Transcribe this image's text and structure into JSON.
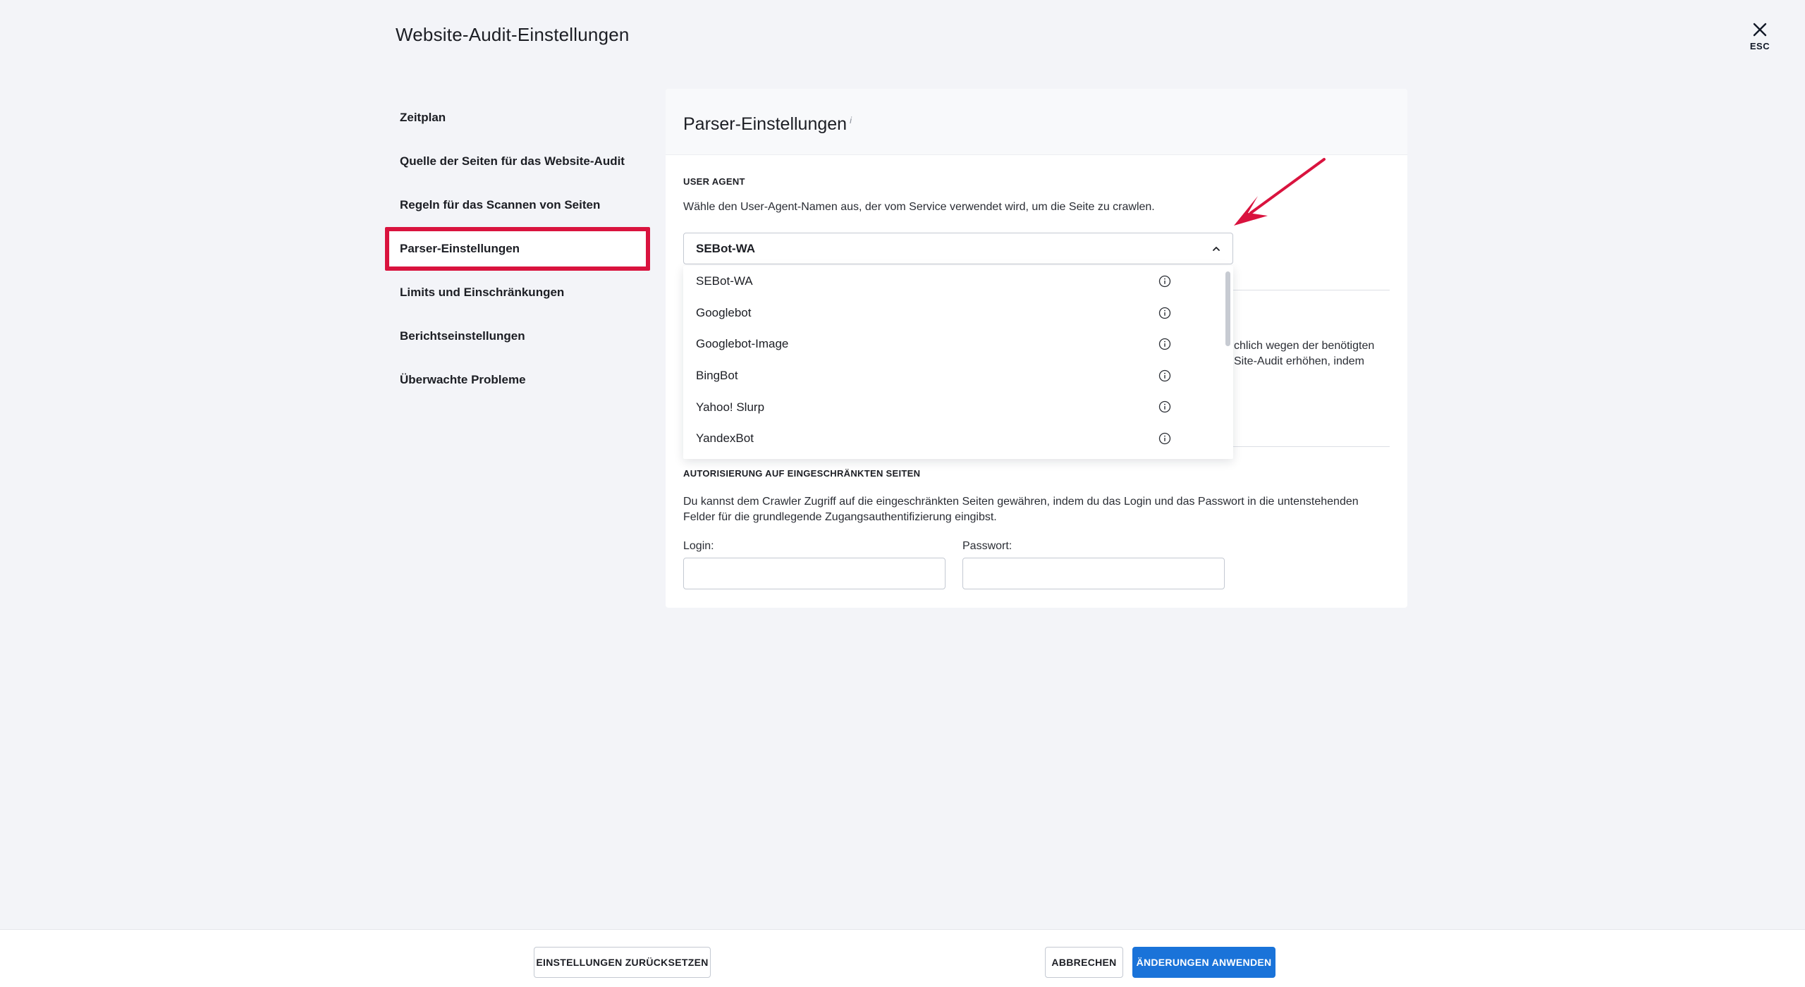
{
  "header": {
    "title": "Website-Audit-Einstellungen",
    "esc_label": "ESC"
  },
  "nav": {
    "items": [
      {
        "label": "Zeitplan"
      },
      {
        "label": "Quelle der Seiten für das Website-Audit"
      },
      {
        "label": "Regeln für das Scannen von Seiten"
      },
      {
        "label": "Parser-Einstellungen",
        "active": true
      },
      {
        "label": "Limits und Einschränkungen"
      },
      {
        "label": "Berichtseinstellungen"
      },
      {
        "label": "Überwachte Probleme"
      }
    ]
  },
  "panel": {
    "title": "Parser-Einstellungen",
    "title_info": "i",
    "user_agent": {
      "label": "USER AGENT",
      "description": "Wähle den User-Agent-Namen aus, der vom Service verwendet wird, um die Seite zu crawlen.",
      "selected": "SEBot-WA",
      "options": [
        {
          "label": "SEBot-WA"
        },
        {
          "label": "Googlebot"
        },
        {
          "label": "Googlebot-Image"
        },
        {
          "label": "BingBot"
        },
        {
          "label": "Yahoo! Slurp"
        },
        {
          "label": "YandexBot"
        }
      ]
    },
    "hidden_text": {
      "line1": "chlich wegen der benötigten",
      "line2": "Site-Audit erhöhen, indem"
    },
    "authorization": {
      "label": "AUTORISIERUNG AUF EINGESCHRÄNKTEN SEITEN",
      "description": "Du kannst dem Crawler Zugriff auf die eingeschränkten Seiten gewähren, indem du das Login und das Passwort in die untenstehenden Felder für die grundlegende Zugangsauthentifizierung eingibst.",
      "login_label": "Login:",
      "login_value": "",
      "password_label": "Passwort:",
      "password_value": ""
    }
  },
  "footer": {
    "reset_label": "EINSTELLUNGEN ZURÜCKSETZEN",
    "cancel_label": "ABBRECHEN",
    "apply_label": "ÄNDERUNGEN ANWENDEN"
  },
  "colors": {
    "highlight": "#d9133e",
    "primary": "#1a73d9",
    "arrow": "#d9133e"
  },
  "icons": {
    "close": "close-icon",
    "chevron": "chevron-up-icon",
    "info": "info-circle-icon",
    "arrow": "annotation-arrow"
  }
}
